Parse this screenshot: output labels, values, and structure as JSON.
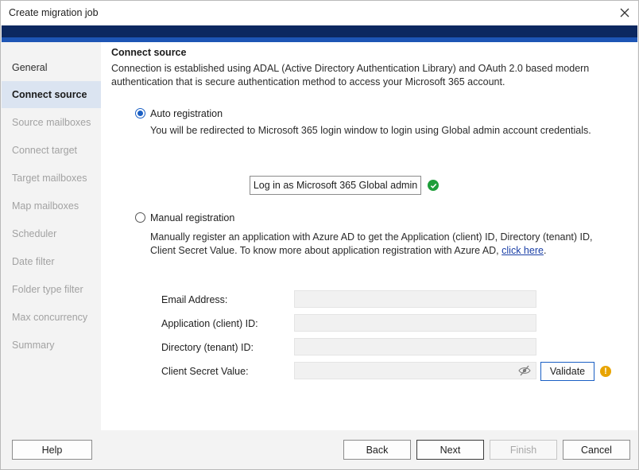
{
  "window": {
    "title": "Create migration job"
  },
  "sidebar": {
    "items": [
      {
        "label": "General"
      },
      {
        "label": "Connect source"
      },
      {
        "label": "Source mailboxes"
      },
      {
        "label": "Connect target"
      },
      {
        "label": "Target mailboxes"
      },
      {
        "label": "Map mailboxes"
      },
      {
        "label": "Scheduler"
      },
      {
        "label": "Date filter"
      },
      {
        "label": "Folder type filter"
      },
      {
        "label": "Max concurrency"
      },
      {
        "label": "Summary"
      }
    ],
    "active_label": "Connect source"
  },
  "main": {
    "title": "Connect source",
    "description": "Connection is established using ADAL (Active Directory Authentication Library) and OAuth 2.0 based modern authentication that is secure authentication method to access your Microsoft 365 account.",
    "auto": {
      "label": "Auto registration",
      "selected": true,
      "description": "You will be redirected to Microsoft 365 login window to login using Global admin account credentials.",
      "login_button": "Log in as Microsoft 365 Global admin",
      "login_status_icon": "check-circle-icon",
      "status_color": "#1e9e3a"
    },
    "manual": {
      "label": "Manual registration",
      "selected": false,
      "description": "Manually register an application with Azure AD to get the Application (client) ID, Directory (tenant) ID, Client Secret Value. To know more about application registration with Azure AD, ",
      "link_text": "click here",
      "trailing": "."
    },
    "fields": {
      "email": {
        "label": "Email Address:",
        "value": ""
      },
      "client_id": {
        "label": "Application (client) ID:",
        "value": ""
      },
      "tenant_id": {
        "label": "Directory (tenant) ID:",
        "value": ""
      },
      "secret": {
        "label": "Client Secret Value:",
        "value": ""
      }
    },
    "validate_button": "Validate",
    "warning_icon": "exclamation-circle-icon",
    "warning_color": "#e8a400"
  },
  "footer": {
    "help": "Help",
    "back": "Back",
    "next": "Next",
    "finish": "Finish",
    "cancel": "Cancel"
  },
  "colors": {
    "banner_dark": "#0c2860",
    "banner_light": "#1d55b5",
    "accent": "#1a5fc4",
    "active_nav_bg": "#dbe4f1"
  }
}
